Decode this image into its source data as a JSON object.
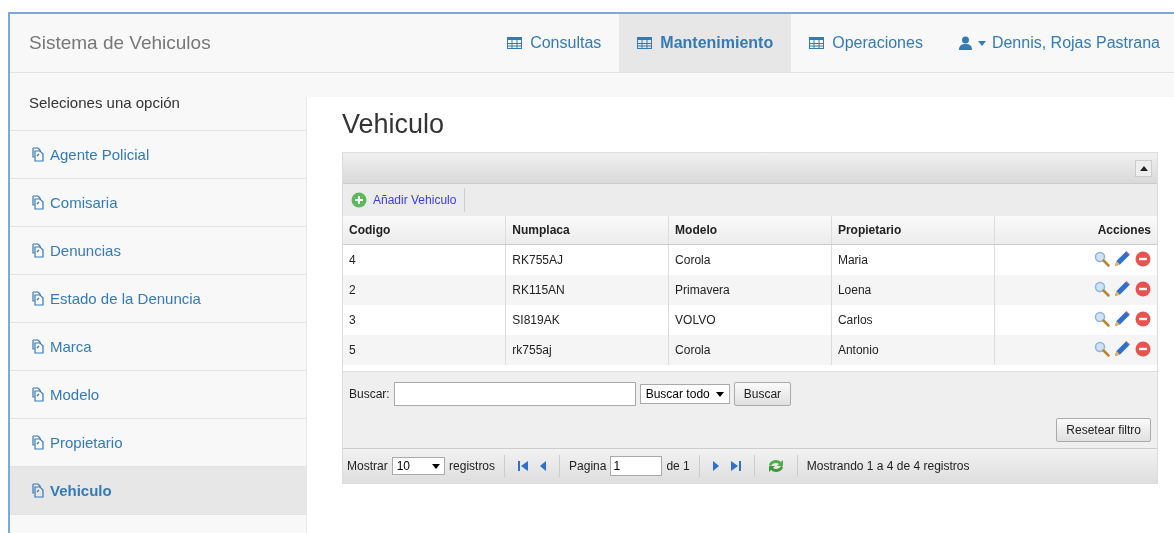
{
  "navbar": {
    "brand": "Sistema de Vehiculos",
    "items": [
      {
        "label": "Consultas",
        "selected": false
      },
      {
        "label": "Mantenimiento",
        "selected": true
      },
      {
        "label": "Operaciones",
        "selected": false
      }
    ],
    "user": "Dennis, Rojas Pastrana"
  },
  "sidebar": {
    "heading": "Seleciones una opción",
    "items": [
      {
        "label": "Agente Policial",
        "selected": false
      },
      {
        "label": "Comisaria",
        "selected": false
      },
      {
        "label": "Denuncias",
        "selected": false
      },
      {
        "label": "Estado de la Denuncia",
        "selected": false
      },
      {
        "label": "Marca",
        "selected": false
      },
      {
        "label": "Modelo",
        "selected": false
      },
      {
        "label": "Propietario",
        "selected": false
      },
      {
        "label": "Vehiculo",
        "selected": true
      }
    ]
  },
  "page_title": "Vehiculo",
  "grid": {
    "add_button": "Añadir Vehiculo",
    "columns": [
      "Codigo",
      "Numplaca",
      "Modelo",
      "Propietario",
      "Acciones"
    ],
    "rows": [
      {
        "cells": [
          "4",
          "RK755AJ",
          "Corola",
          "Maria"
        ]
      },
      {
        "cells": [
          "2",
          "RK115AN",
          "Primavera",
          "Loena"
        ]
      },
      {
        "cells": [
          "3",
          "SI819AK",
          "VOLVO",
          "Carlos"
        ]
      },
      {
        "cells": [
          "5",
          "rk755aj",
          "Corola",
          "Antonio"
        ]
      }
    ],
    "search": {
      "label": "Buscar:",
      "scope": "Buscar todo",
      "button": "Buscar",
      "reset": "Resetear filtro"
    },
    "pager": {
      "show_label": "Mostrar",
      "page_size": "10",
      "records_label": "registros",
      "page_label": "Pagina",
      "page": "1",
      "of": "de 1",
      "info": "Mostrando 1 a 4 de 4 registros"
    }
  }
}
